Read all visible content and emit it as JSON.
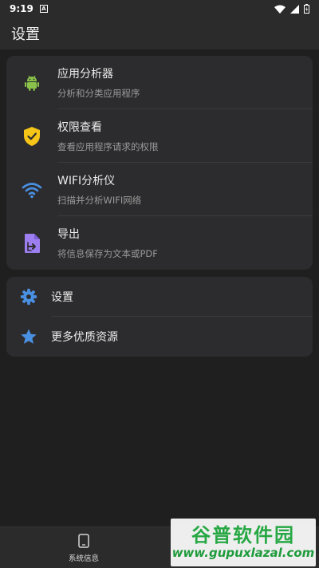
{
  "status_bar": {
    "time": "9:19",
    "notif_letter": "A"
  },
  "app_bar": {
    "title": "设置"
  },
  "tools": [
    {
      "title": "应用分析器",
      "subtitle": "分析和分类应用程序",
      "icon": "android-icon",
      "color": "#8bc34a"
    },
    {
      "title": "权限查看",
      "subtitle": "查看应用程序请求的权限",
      "icon": "shield-check-icon",
      "color": "#f5c518"
    },
    {
      "title": "WIFI分析仪",
      "subtitle": "扫描并分析WIFI网络",
      "icon": "wifi-icon",
      "color": "#4a90e2"
    },
    {
      "title": "导出",
      "subtitle": "将信息保存为文本或PDF",
      "icon": "export-file-icon",
      "color": "#9c7ef0"
    }
  ],
  "settings": [
    {
      "label": "设置",
      "icon": "gear-icon",
      "color": "#4a90e2"
    },
    {
      "label": "更多优质资源",
      "icon": "star-icon",
      "color": "#4a90e2"
    }
  ],
  "bottom_nav": {
    "items": [
      {
        "label": "系统信息",
        "icon": "phone-icon"
      }
    ]
  },
  "watermark": {
    "cn": "谷普软件园",
    "url": "www.gupuxlazal.com"
  }
}
